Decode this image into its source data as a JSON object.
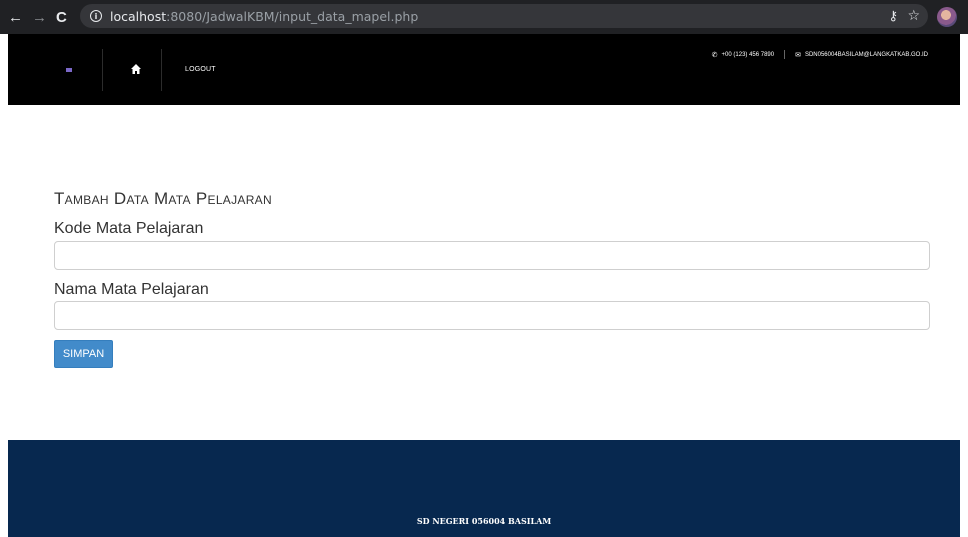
{
  "browser": {
    "url_host": "localhost",
    "url_rest": ":8080/JadwalKBM/input_data_mapel.php"
  },
  "topbar": {
    "logout_label": "LOGOUT",
    "phone": "+00 (123) 456 7890",
    "email": "SDN056004BASILAM@LANGKATKAB.GO.ID"
  },
  "form": {
    "title": "Tambah Data Mata Pelajaran",
    "kode_label": "Kode Mata Pelajaran",
    "kode_value": "",
    "nama_label": "Nama Mata Pelajaran",
    "nama_value": "",
    "submit_label": "SIMPAN"
  },
  "footer": {
    "text": "SD NEGERI 056004 BASILAM"
  },
  "colors": {
    "topbar_bg": "#000000",
    "footer_bg": "#07284f",
    "button_bg": "#428bca"
  }
}
